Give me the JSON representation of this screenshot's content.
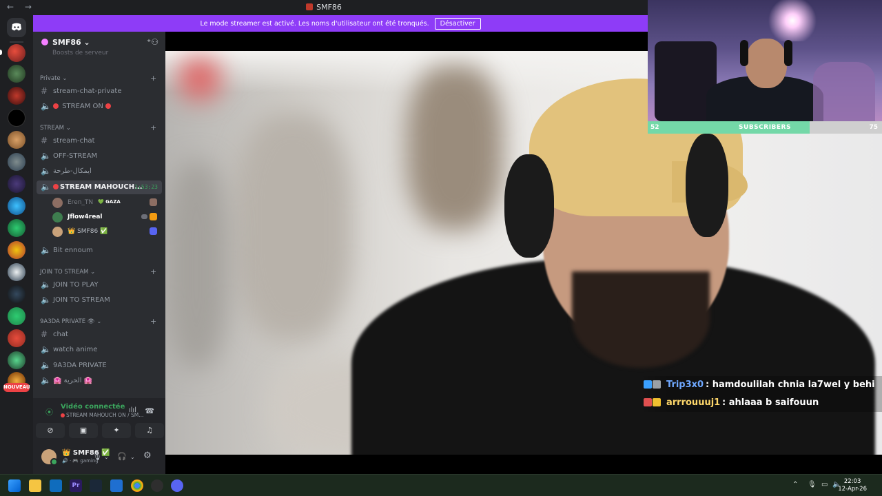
{
  "window": {
    "title": "SMF86",
    "nav": "← →"
  },
  "banner": {
    "text": "Le mode streamer est activé. Les noms d'utilisateur ont été tronqués.",
    "button": "Désactiver"
  },
  "rail": {
    "new_badge": "NOUVEAU"
  },
  "server": {
    "name": "SMF86 ⌄",
    "cutoff_item": "Boosts de serveur"
  },
  "categories": [
    {
      "label": "Private ⌄"
    },
    {
      "label": "STREAM ⌄"
    },
    {
      "label": "JOIN TO STREAM ⌄"
    },
    {
      "label": "9A3DA PRIVATE 👁 ⌄"
    }
  ],
  "channels": {
    "stream_chat_private": "stream-chat-private",
    "stream_on": "STREAM ON",
    "stream_chat": "stream-chat",
    "off_stream": "OFF-STREAM",
    "arabic": "ايمكال-طرحة",
    "stream_mahouch": "STREAM MAHOUCH...",
    "stream_timer": "1:53:23",
    "bit_ennoum": "Bit ennoum",
    "join_to_play": "JOIN TO PLAY",
    "join_to_stream": "JOIN TO STREAM",
    "chat": "chat",
    "watch_anime": "watch anime",
    "private_9a3da": "9A3DA PRIVATE",
    "hurriya": "🏩 الحرية 🏩"
  },
  "voice_users": [
    {
      "name": "Eren_TN",
      "tag": "💚 GAZA"
    },
    {
      "name": "Jflow4real"
    },
    {
      "name": "👑 SMF86 ✅"
    }
  ],
  "voice_panel": {
    "status": "Vidéo connectée",
    "channel": "STREAM MAHOUCH ON / SM..."
  },
  "me": {
    "name": "👑 SMF86 ✅",
    "status": "🔊 · 🎮 gaming"
  },
  "subscribers": {
    "label": "SUBSCRIBERS",
    "current": "52",
    "goal": "75",
    "progress": 0.69
  },
  "chat": [
    {
      "name": "Trip3x0",
      "text": ": hamdoulilah chnia la7wel y behi",
      "name_color": "#6fa8ff",
      "badges": [
        "#3aa0ff",
        "#9aa0a6"
      ]
    },
    {
      "name": "arrrouuuj1",
      "text": ": ahlaaa b saifouun",
      "name_color": "#ffd86b",
      "badges": [
        "#e05050",
        "#f0c030"
      ]
    }
  ],
  "taskbar": {
    "time": "22:03",
    "date": "12-Apr-26"
  },
  "colors": {
    "accent": "#8e3cf7",
    "online": "#3ba55d",
    "live": "#ed4245"
  }
}
